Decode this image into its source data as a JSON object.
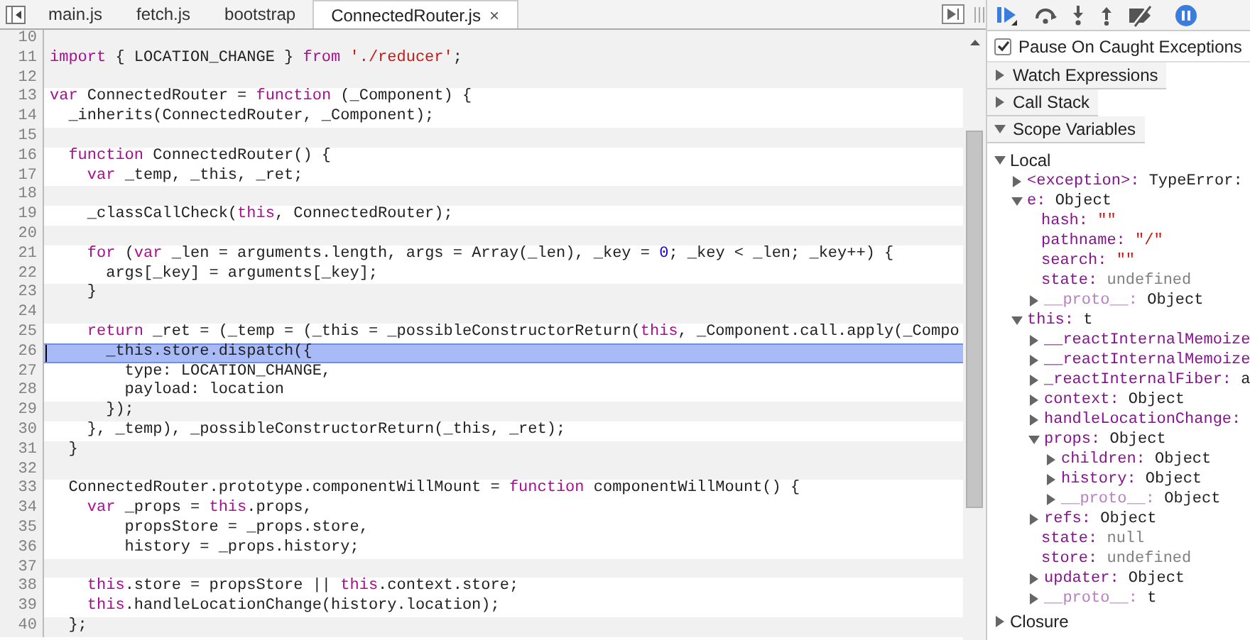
{
  "tabs": [
    {
      "label": "main.js",
      "selected": false
    },
    {
      "label": "fetch.js",
      "selected": false
    },
    {
      "label": "bootstrap",
      "selected": false
    },
    {
      "label": "ConnectedRouter.js",
      "selected": true,
      "close_glyph": "×"
    }
  ],
  "lines": [
    {
      "number": "10",
      "shaded": true,
      "current": false
    },
    {
      "number": "11",
      "shaded": true,
      "current": false,
      "tokens": [
        {
          "kind": "keyword",
          "text": "import"
        },
        {
          "kind": "plain",
          "text": " { LOCATION_CHANGE } "
        },
        {
          "kind": "keyword",
          "text": "from"
        },
        {
          "kind": "string",
          "text": " './reducer'"
        },
        {
          "kind": "plain",
          "text": ";"
        }
      ]
    },
    {
      "number": "12",
      "shaded": true,
      "current": false
    },
    {
      "number": "13",
      "shaded": false,
      "current": false,
      "tokens": [
        {
          "kind": "keyword",
          "text": "var"
        },
        {
          "kind": "plain",
          "text": " ConnectedRouter = "
        },
        {
          "kind": "keyword",
          "text": "function"
        },
        {
          "kind": "plain",
          "text": " (_Component) {"
        }
      ]
    },
    {
      "number": "14",
      "shaded": false,
      "current": false,
      "tokens": [
        {
          "kind": "plain",
          "text": "  _inherits(ConnectedRouter, _Component);"
        }
      ]
    },
    {
      "number": "15",
      "shaded": true,
      "current": false
    },
    {
      "number": "16",
      "shaded": false,
      "current": false,
      "tokens": [
        {
          "kind": "keyword",
          "text": "  function"
        },
        {
          "kind": "plain",
          "text": " ConnectedRouter() {"
        }
      ]
    },
    {
      "number": "17",
      "shaded": false,
      "current": false,
      "tokens": [
        {
          "kind": "keyword",
          "text": "    var"
        },
        {
          "kind": "plain",
          "text": " _temp, _this, _ret;"
        }
      ]
    },
    {
      "number": "18",
      "shaded": true,
      "current": false
    },
    {
      "number": "19",
      "shaded": false,
      "current": false,
      "tokens": [
        {
          "kind": "plain",
          "text": "    _classCallCheck("
        },
        {
          "kind": "keyword",
          "text": "this"
        },
        {
          "kind": "plain",
          "text": ", ConnectedRouter);"
        }
      ]
    },
    {
      "number": "20",
      "shaded": true,
      "current": false
    },
    {
      "number": "21",
      "shaded": false,
      "current": false,
      "tokens": [
        {
          "kind": "keyword",
          "text": "    for"
        },
        {
          "kind": "plain",
          "text": " ("
        },
        {
          "kind": "keyword",
          "text": "var"
        },
        {
          "kind": "plain",
          "text": " _len = arguments.length, args = Array(_len), _key = "
        },
        {
          "kind": "number",
          "text": "0"
        },
        {
          "kind": "plain",
          "text": "; _key < _len; _key++) {"
        }
      ]
    },
    {
      "number": "22",
      "shaded": false,
      "current": false,
      "tokens": [
        {
          "kind": "plain",
          "text": "      args[_key] = arguments[_key];"
        }
      ]
    },
    {
      "number": "23",
      "shaded": true,
      "current": false,
      "tokens": [
        {
          "kind": "plain",
          "text": "    }"
        }
      ]
    },
    {
      "number": "24",
      "shaded": true,
      "current": false
    },
    {
      "number": "25",
      "shaded": false,
      "current": false,
      "tokens": [
        {
          "kind": "keyword",
          "text": "    return"
        },
        {
          "kind": "plain",
          "text": " _ret = (_temp = (_this = _possibleConstructorReturn("
        },
        {
          "kind": "keyword",
          "text": "this"
        },
        {
          "kind": "plain",
          "text": ", _Component.call.apply(_Compo"
        }
      ]
    },
    {
      "number": "26",
      "shaded": false,
      "current": true,
      "tokens": [
        {
          "kind": "plain",
          "text": "      _this.store.dispatch({"
        }
      ]
    },
    {
      "number": "27",
      "shaded": false,
      "current": false,
      "tokens": [
        {
          "kind": "plain",
          "text": "        type: LOCATION_CHANGE,"
        }
      ]
    },
    {
      "number": "28",
      "shaded": false,
      "current": false,
      "tokens": [
        {
          "kind": "plain",
          "text": "        payload: location"
        }
      ]
    },
    {
      "number": "29",
      "shaded": true,
      "current": false,
      "tokens": [
        {
          "kind": "plain",
          "text": "      });"
        }
      ]
    },
    {
      "number": "30",
      "shaded": false,
      "current": false,
      "tokens": [
        {
          "kind": "plain",
          "text": "    }, _temp), _possibleConstructorReturn(_this, _ret);"
        }
      ]
    },
    {
      "number": "31",
      "shaded": true,
      "current": false,
      "tokens": [
        {
          "kind": "plain",
          "text": "  }"
        }
      ]
    },
    {
      "number": "32",
      "shaded": true,
      "current": false
    },
    {
      "number": "33",
      "shaded": false,
      "current": false,
      "tokens": [
        {
          "kind": "plain",
          "text": "  ConnectedRouter.prototype.componentWillMount = "
        },
        {
          "kind": "keyword",
          "text": "function"
        },
        {
          "kind": "plain",
          "text": " componentWillMount() {"
        }
      ]
    },
    {
      "number": "34",
      "shaded": false,
      "current": false,
      "tokens": [
        {
          "kind": "keyword",
          "text": "    var"
        },
        {
          "kind": "plain",
          "text": " _props = "
        },
        {
          "kind": "keyword",
          "text": "this"
        },
        {
          "kind": "plain",
          "text": ".props,"
        }
      ]
    },
    {
      "number": "35",
      "shaded": false,
      "current": false,
      "tokens": [
        {
          "kind": "plain",
          "text": "        propsStore = _props.store,"
        }
      ]
    },
    {
      "number": "36",
      "shaded": false,
      "current": false,
      "tokens": [
        {
          "kind": "plain",
          "text": "        history = _props.history;"
        }
      ]
    },
    {
      "number": "37",
      "shaded": true,
      "current": false
    },
    {
      "number": "38",
      "shaded": false,
      "current": false,
      "tokens": [
        {
          "kind": "keyword",
          "text": "    this"
        },
        {
          "kind": "plain",
          "text": ".store = propsStore || "
        },
        {
          "kind": "keyword",
          "text": "this"
        },
        {
          "kind": "plain",
          "text": ".context.store;"
        }
      ]
    },
    {
      "number": "39",
      "shaded": false,
      "current": false,
      "tokens": [
        {
          "kind": "keyword",
          "text": "    this"
        },
        {
          "kind": "plain",
          "text": ".handleLocationChange(history.location);"
        }
      ]
    },
    {
      "number": "40",
      "shaded": true,
      "current": false,
      "tokens": [
        {
          "kind": "plain",
          "text": "  };"
        }
      ]
    }
  ],
  "sidebar": {
    "pause_on_caught": {
      "label": "Pause On Caught Exceptions",
      "checked": true
    },
    "sections": [
      {
        "title": "Watch Expressions",
        "expanded": false
      },
      {
        "title": "Call Stack",
        "expanded": false
      },
      {
        "title": "Scope Variables",
        "expanded": true
      }
    ],
    "scope_tree": [
      {
        "kind": "scope",
        "label": "Local",
        "expanded": true,
        "children": [
          {
            "kind": "property",
            "name": "<exception>:",
            "value": {
              "text": "TypeError:",
              "color": "#222222"
            },
            "dimmed": false,
            "expanded": false
          },
          {
            "kind": "property",
            "name": "e:",
            "value": {
              "text": "Object",
              "color": "#222222"
            },
            "dimmed": false,
            "expanded": true,
            "children": [
              {
                "kind": "property",
                "name": "hash:",
                "value": {
                  "text": "\"\"",
                  "color": "#c41a16"
                },
                "dimmed": false
              },
              {
                "kind": "property",
                "name": "pathname:",
                "value": {
                  "text": "\"/\"",
                  "color": "#c41a16"
                },
                "dimmed": false
              },
              {
                "kind": "property",
                "name": "search:",
                "value": {
                  "text": "\"\"",
                  "color": "#c41a16"
                },
                "dimmed": false
              },
              {
                "kind": "property",
                "name": "state:",
                "value": {
                  "text": "undefined",
                  "color": "#808080"
                },
                "dimmed": false
              },
              {
                "kind": "property",
                "name": "__proto__:",
                "value": {
                  "text": "Object",
                  "color": "#222222"
                },
                "dimmed": true,
                "expanded": false
              }
            ]
          },
          {
            "kind": "property",
            "name": "this:",
            "value": {
              "text": "t",
              "color": "#222222"
            },
            "dimmed": false,
            "expanded": true,
            "children": [
              {
                "kind": "property",
                "name": "__reactInternalMemoize",
                "dimmed": false,
                "expanded": false
              },
              {
                "kind": "property",
                "name": "__reactInternalMemoize",
                "dimmed": false,
                "expanded": false
              },
              {
                "kind": "property",
                "name": "_reactInternalFiber:",
                "value": {
                  "text": "a",
                  "color": "#222222"
                },
                "dimmed": false,
                "expanded": false
              },
              {
                "kind": "property",
                "name": "context:",
                "value": {
                  "text": "Object",
                  "color": "#222222"
                },
                "dimmed": false,
                "expanded": false
              },
              {
                "kind": "property",
                "name": "handleLocationChange:",
                "dimmed": false,
                "expanded": false
              },
              {
                "kind": "property",
                "name": "props:",
                "value": {
                  "text": "Object",
                  "color": "#222222"
                },
                "dimmed": false,
                "expanded": true,
                "children": [
                  {
                    "kind": "property",
                    "name": "children:",
                    "value": {
                      "text": "Object",
                      "color": "#222222"
                    },
                    "dimmed": false,
                    "expanded": false
                  },
                  {
                    "kind": "property",
                    "name": "history:",
                    "value": {
                      "text": "Object",
                      "color": "#222222"
                    },
                    "dimmed": false,
                    "expanded": false
                  },
                  {
                    "kind": "property",
                    "name": "__proto__:",
                    "value": {
                      "text": "Object",
                      "color": "#222222"
                    },
                    "dimmed": true,
                    "expanded": false
                  }
                ]
              },
              {
                "kind": "property",
                "name": "refs:",
                "value": {
                  "text": "Object",
                  "color": "#222222"
                },
                "dimmed": false,
                "expanded": false
              },
              {
                "kind": "property",
                "name": "state:",
                "value": {
                  "text": "null",
                  "color": "#808080"
                },
                "dimmed": false
              },
              {
                "kind": "property",
                "name": "store:",
                "value": {
                  "text": "undefined",
                  "color": "#808080"
                },
                "dimmed": false
              },
              {
                "kind": "property",
                "name": "updater:",
                "value": {
                  "text": "Object",
                  "color": "#222222"
                },
                "dimmed": false,
                "expanded": false
              },
              {
                "kind": "property",
                "name": "__proto__:",
                "value": {
                  "text": "t",
                  "color": "#222222"
                },
                "dimmed": true,
                "expanded": false
              }
            ]
          }
        ]
      },
      {
        "kind": "scope",
        "label": "Closure",
        "expanded": false
      }
    ]
  }
}
